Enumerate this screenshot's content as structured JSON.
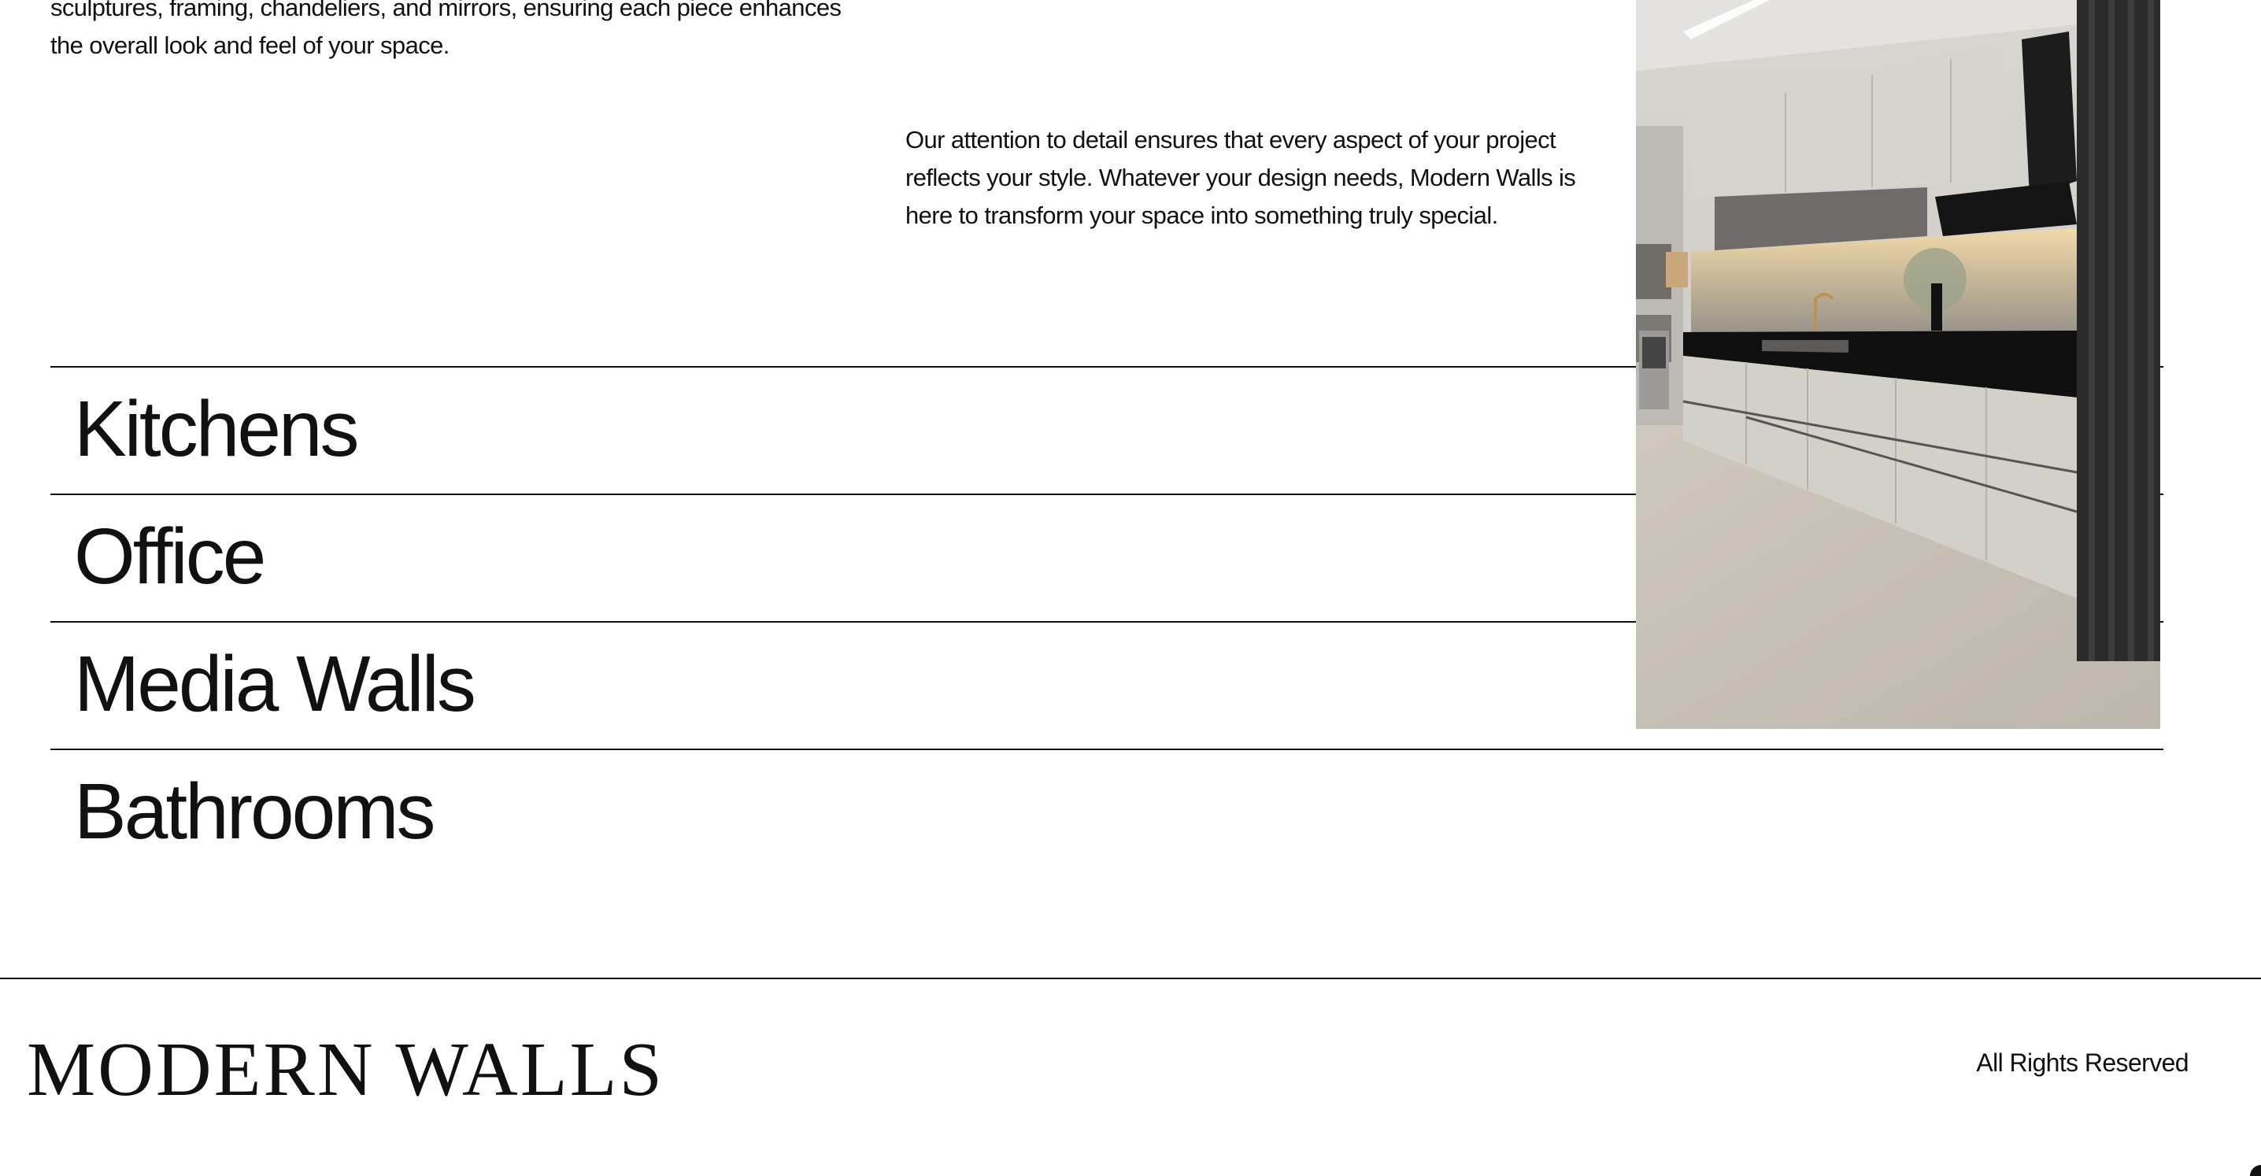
{
  "intro": {
    "left_text": "sculptures, framing, chandeliers, and mirrors, ensuring each piece enhances the overall look and feel of your space.",
    "right_text": "Our attention to detail ensures that every aspect of your project reflects your style. Whatever your design needs, Modern Walls is here to transform your space into something truly special."
  },
  "categories": [
    {
      "label": "Kitchens"
    },
    {
      "label": "Office"
    },
    {
      "label": "Media Walls"
    },
    {
      "label": "Bathrooms"
    }
  ],
  "preview_image": {
    "subject": "modern kitchen with light grey cabinets and black countertop"
  },
  "footer": {
    "brand": "MODERN WALLS",
    "rights": "All Rights Reserved"
  },
  "colors": {
    "background": "#ffffff",
    "text": "#111111",
    "divider": "#111111"
  }
}
